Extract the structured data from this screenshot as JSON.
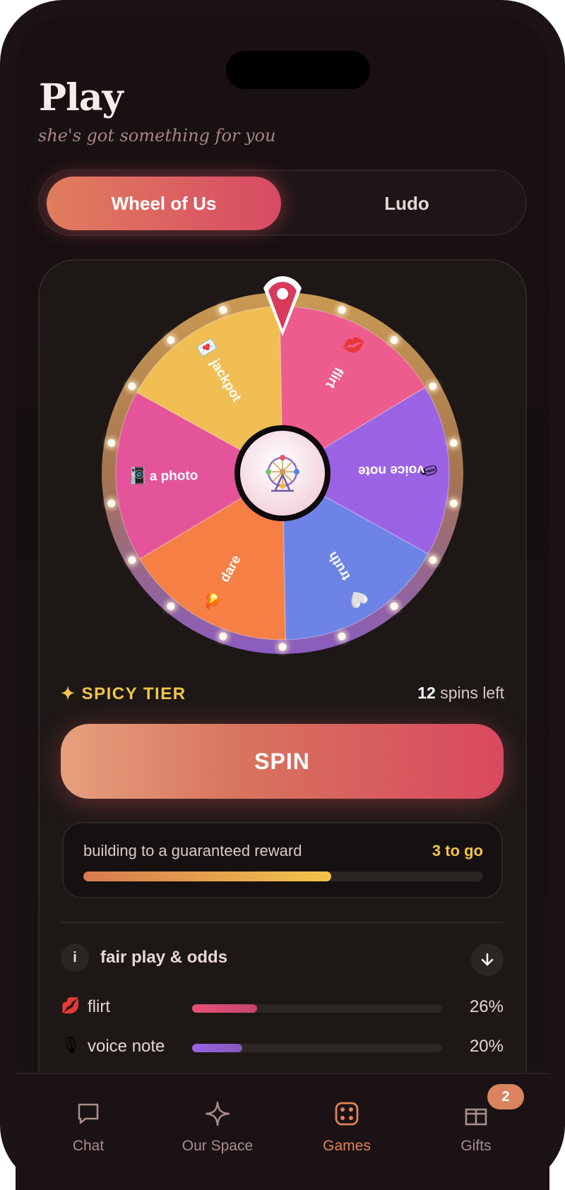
{
  "header": {
    "title": "Play",
    "subtitle": "she's got something for you"
  },
  "tabs": [
    {
      "label": "Wheel of Us",
      "active": true
    },
    {
      "label": "Ludo",
      "active": false
    }
  ],
  "wheel": {
    "center_icon": "ferris-wheel-icon",
    "segments": [
      {
        "label": "flirt",
        "icon": "💋",
        "color": "#ec5c8c"
      },
      {
        "label": "voice note",
        "icon": "🎙",
        "color": "#9b63e4"
      },
      {
        "label": "truth",
        "icon": "🤍",
        "color": "#6d84e6"
      },
      {
        "label": "dare",
        "icon": "🔥",
        "color": "#f57f45"
      },
      {
        "label": "a photo",
        "icon": "📷",
        "color": "#e4549a"
      },
      {
        "label": "jackpot",
        "icon": "💌",
        "color": "#f0be52"
      }
    ]
  },
  "tier": {
    "label": "SPICY TIER",
    "spins_count": "12",
    "spins_suffix": "spins left"
  },
  "spin_button": {
    "label": "SPIN"
  },
  "reward": {
    "label": "building to a guaranteed reward",
    "remaining": "3 to go",
    "progress": 0.62
  },
  "odds": {
    "label": "fair play & odds",
    "items": [
      {
        "emoji": "💋",
        "name": "flirt",
        "percent": "26%",
        "value": 0.26,
        "color": "#e8507a"
      },
      {
        "emoji": "🎙",
        "name": "voice note",
        "percent": "20%",
        "value": 0.2,
        "color": "#9b63e4"
      }
    ]
  },
  "nav": {
    "items": [
      {
        "label": "Chat",
        "icon": "chat-bubble-icon",
        "active": false
      },
      {
        "label": "Our Space",
        "icon": "sparkle-icon",
        "active": false
      },
      {
        "label": "Games",
        "icon": "dice-icon",
        "active": true
      },
      {
        "label": "Gifts",
        "icon": "gift-icon",
        "active": false,
        "badge": "2"
      }
    ]
  }
}
